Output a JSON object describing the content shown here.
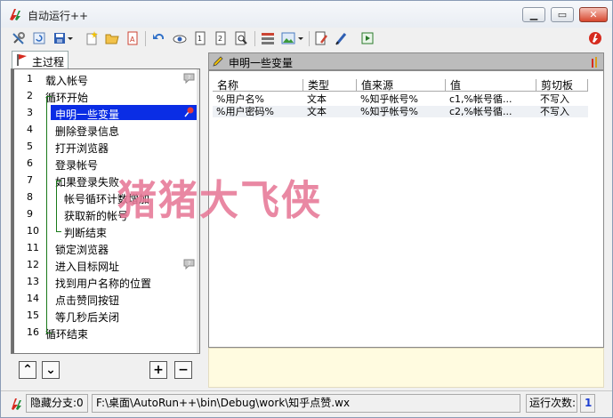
{
  "window": {
    "title": "自动运行++"
  },
  "tab": {
    "label": "主过程"
  },
  "steps": [
    {
      "num": "1",
      "text": "载入帐号",
      "marker": "comment"
    },
    {
      "num": "2",
      "text": "循环开始"
    },
    {
      "num": "3",
      "text": "申明一些变量",
      "selected": true,
      "marker": "pin"
    },
    {
      "num": "4",
      "text": "删除登录信息"
    },
    {
      "num": "5",
      "text": "打开浏览器"
    },
    {
      "num": "6",
      "text": "登录帐号"
    },
    {
      "num": "7",
      "text": "如果登录失败"
    },
    {
      "num": "8",
      "text": "帐号循环计数增加"
    },
    {
      "num": "9",
      "text": "获取新的帐号"
    },
    {
      "num": "10",
      "text": "判断结束"
    },
    {
      "num": "11",
      "text": "锁定浏览器"
    },
    {
      "num": "12",
      "text": "进入目标网址",
      "marker": "comment"
    },
    {
      "num": "13",
      "text": "找到用户名称的位置"
    },
    {
      "num": "14",
      "text": "点击赞同按钮"
    },
    {
      "num": "15",
      "text": "等几秒后关闭"
    },
    {
      "num": "16",
      "text": "循环结束"
    }
  ],
  "panel": {
    "title": "申明一些变量"
  },
  "table": {
    "headers": [
      "名称",
      "类型",
      "值来源",
      "值",
      "剪切板"
    ],
    "rows": [
      [
        "%用户名%",
        "文本",
        "%知乎帐号%",
        "c1,%帐号循...",
        "不写入"
      ],
      [
        "%用户密码%",
        "文本",
        "%知乎帐号%",
        "c2,%帐号循...",
        "不写入"
      ]
    ]
  },
  "status": {
    "hidden_branch": "隐藏分支:0",
    "path": "F:\\桌面\\AutoRun++\\bin\\Debug\\work\\知乎点赞.wx",
    "run_count_label": "运行次数:",
    "run_count_value": "1"
  },
  "watermark": "猪猪大飞侠",
  "colors": {
    "selection": "#0a2de5",
    "gutter": "#6f6f6f",
    "note_bg": "#fffbe0"
  }
}
